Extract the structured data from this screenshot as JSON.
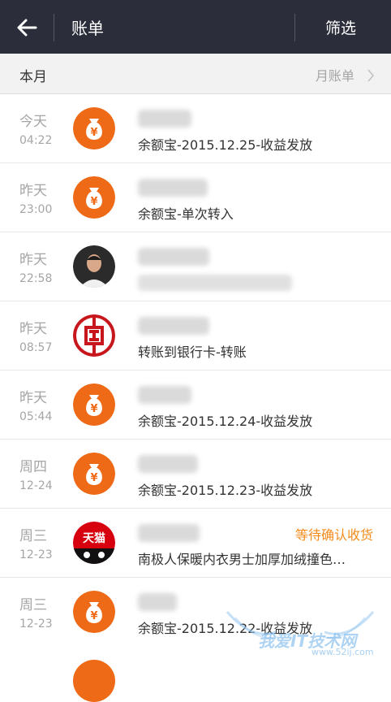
{
  "header": {
    "title": "账单",
    "filter_label": "筛选"
  },
  "section": {
    "title": "本月",
    "monthly_bill_label": "月账单"
  },
  "transactions": [
    {
      "day": "今天",
      "time": "04:22",
      "icon": "money-bag-icon",
      "description": "余额宝-2015.12.25-收益发放",
      "status": ""
    },
    {
      "day": "昨天",
      "time": "23:00",
      "icon": "money-bag-icon",
      "description": "余额宝-单次转入",
      "status": ""
    },
    {
      "day": "昨天",
      "time": "22:58",
      "icon": "avatar-photo",
      "description": "",
      "status": ""
    },
    {
      "day": "昨天",
      "time": "08:57",
      "icon": "icbc-bank-icon",
      "description": "转账到银行卡-转账",
      "status": ""
    },
    {
      "day": "昨天",
      "time": "05:44",
      "icon": "money-bag-icon",
      "description": "余额宝-2015.12.24-收益发放",
      "status": ""
    },
    {
      "day": "周四",
      "time": "12-24",
      "icon": "money-bag-icon",
      "description": "余额宝-2015.12.23-收益发放",
      "status": ""
    },
    {
      "day": "周三",
      "time": "12-23",
      "icon": "tmall-icon",
      "icon_text": "天猫",
      "description": "南极人保暖内衣男士加厚加绒撞色…",
      "status": "等待确认收货"
    },
    {
      "day": "周三",
      "time": "12-23",
      "icon": "money-bag-icon",
      "description": "余额宝-2015.12.22-收益发放",
      "status": ""
    }
  ],
  "watermark": {
    "text": "我爱IT技术网",
    "url": "www.52ij.com"
  },
  "colors": {
    "header_bg": "#2b2d3a",
    "money_orange": "#ee6a17",
    "icbc_red": "#c8161d",
    "status_orange": "#f28b1b",
    "tmall_red": "#d7000f"
  }
}
